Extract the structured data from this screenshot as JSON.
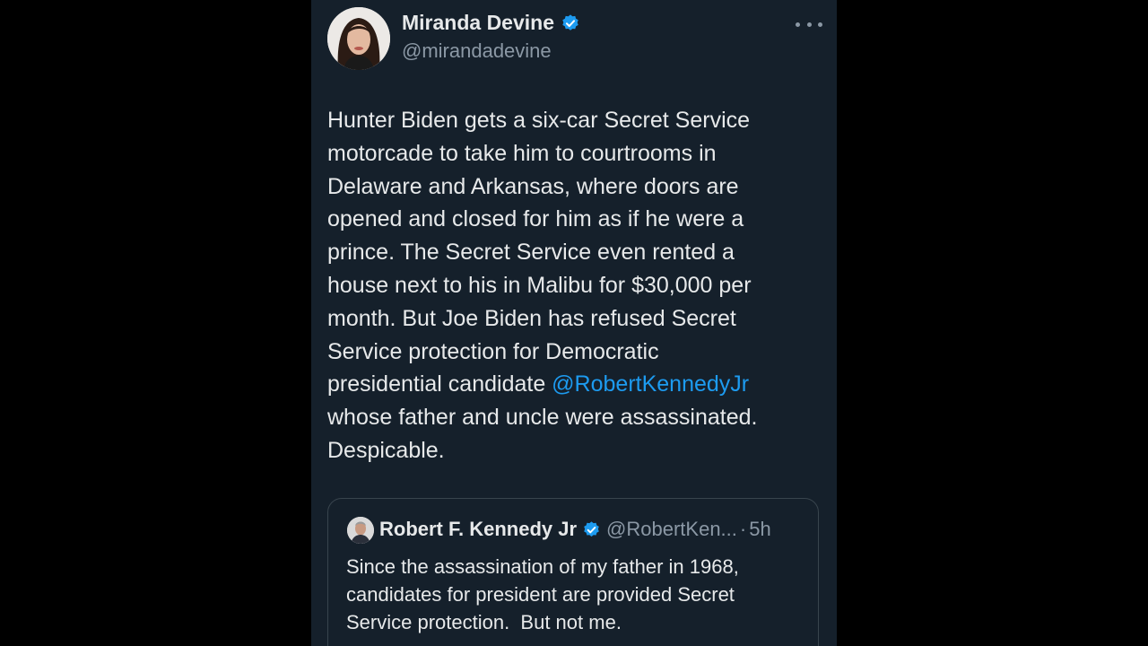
{
  "tweet": {
    "author_name": "Miranda Devine",
    "author_handle": "@mirandadevine",
    "text_lines": [
      "Hunter Biden gets a six-car Secret Service",
      "motorcade to take him to courtrooms in",
      "Delaware and Arkansas, where doors are",
      "opened and closed for him as if he were a",
      "prince. The Secret Service even rented a",
      "house next to his in Malibu for $30,000 per",
      "month. But Joe Biden has refused Secret",
      "Service protection for Democratic",
      "presidential candidate ",
      "whose father and uncle were assassinated.",
      "Despicable."
    ],
    "mention": "@RobertKennedyJr"
  },
  "quote": {
    "author_name": "Robert F. Kennedy Jr",
    "author_handle": "@RobertKen...",
    "separator": "·",
    "time": "5h",
    "text_lines": [
      "Since the assassination of my father in 1968,",
      "candidates for president are provided Secret",
      "Service protection.  But not me."
    ]
  },
  "colors": {
    "background": "#000000",
    "panel": "#15202b",
    "text": "#e7e9ea",
    "secondary": "#8b98a5",
    "accent": "#1d9bf0",
    "border": "#38444d"
  },
  "icons": {
    "verified": "verified-badge-icon",
    "more": "more-options-icon"
  }
}
